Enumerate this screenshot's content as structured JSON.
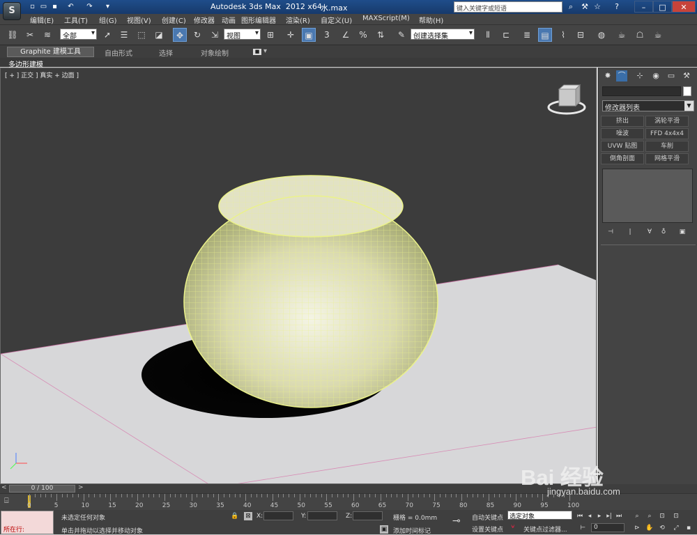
{
  "app": {
    "title": "Autodesk 3ds Max  2012 x64",
    "file": "水.max",
    "search_placeholder": "键入关键字或短语",
    "logo": "3ds-logo"
  },
  "menu": [
    "编辑(E)",
    "工具(T)",
    "组(G)",
    "视图(V)",
    "创建(C)",
    "修改器",
    "动画",
    "图形编辑器",
    "渲染(R)",
    "自定义(U)",
    "MAXScript(M)",
    "帮助(H)"
  ],
  "toolbar": {
    "selection_filter": "全部",
    "ref_coord": "视图",
    "snap_label": "3",
    "percent_label": "%",
    "named_selection": "创建选择集"
  },
  "ribbon": {
    "tabs": [
      "Graphite 建模工具",
      "自由形式",
      "选择",
      "对象绘制"
    ],
    "panel_label": "多边形建模"
  },
  "viewport": {
    "label": "[ + ] 正交 ] 真实 + 边面 ]"
  },
  "command_panel": {
    "modifier_list": "修改器列表",
    "modifiers": [
      "挤出",
      "涡轮平滑",
      "噪波",
      "FFD 4x4x4",
      "UVW 贴图",
      "车削",
      "倒角剖面",
      "网格平滑"
    ]
  },
  "timeline": {
    "slider": "0 / 100",
    "ticks": [
      "0",
      "5",
      "10",
      "15",
      "20",
      "25",
      "30",
      "35",
      "40",
      "45",
      "50",
      "55",
      "60",
      "65",
      "70",
      "75",
      "80",
      "85",
      "90",
      "95",
      "100"
    ]
  },
  "status": {
    "maxscript_label": "所在行:",
    "selection": "未选定任何对象",
    "prompt": "单击并拖动以选择并移动对象",
    "x_label": "X:",
    "y_label": "Y:",
    "z_label": "Z:",
    "grid": "栅格 = 0.0mm",
    "add_time_tag": "添加时间标记",
    "auto_key": "自动关键点",
    "set_key": "设置关键点",
    "selected_object": "选定对象",
    "key_filters": "关键点过滤器...",
    "frame": "0"
  },
  "watermark": {
    "text": "Bai 经验",
    "url": "jingyan.baidu.com"
  }
}
